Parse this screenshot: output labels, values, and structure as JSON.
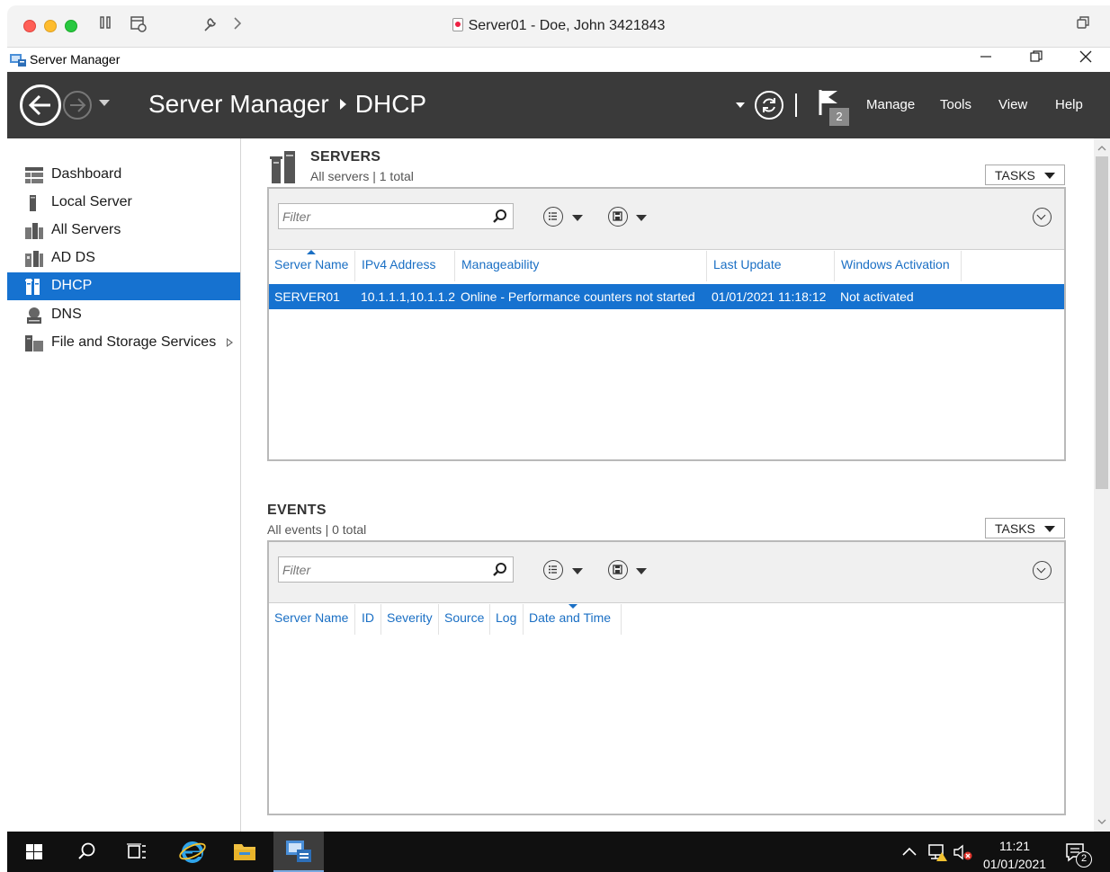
{
  "window": {
    "mac_title": "Server01 - Doe, John 3421843",
    "app_name": "Server Manager"
  },
  "header": {
    "breadcrumb_root": "Server Manager",
    "breadcrumb_current": "DHCP",
    "flag_count": "2",
    "menu": [
      "Manage",
      "Tools",
      "View",
      "Help"
    ]
  },
  "sidebar": {
    "items": [
      {
        "label": "Dashboard",
        "icon": "dashboard-icon"
      },
      {
        "label": "Local Server",
        "icon": "local-server-icon"
      },
      {
        "label": "All Servers",
        "icon": "all-servers-icon"
      },
      {
        "label": "AD DS",
        "icon": "ad-ds-icon"
      },
      {
        "label": "DHCP",
        "icon": "dhcp-icon",
        "active": true
      },
      {
        "label": "DNS",
        "icon": "dns-icon"
      },
      {
        "label": "File and Storage Services",
        "icon": "file-storage-icon",
        "has_submenu": true
      }
    ]
  },
  "servers": {
    "title": "SERVERS",
    "subtitle": "All servers | 1 total",
    "tasks_label": "TASKS",
    "filter_placeholder": "Filter",
    "columns": [
      "Server Name",
      "IPv4 Address",
      "Manageability",
      "Last Update",
      "Windows Activation"
    ],
    "rows": [
      {
        "server_name": "SERVER01",
        "ipv4": "10.1.1.1,10.1.1.2",
        "manageability": "Online - Performance counters not started",
        "last_update": "01/01/2021 11:18:12",
        "activation": "Not activated"
      }
    ]
  },
  "events": {
    "title": "EVENTS",
    "subtitle": "All events | 0 total",
    "tasks_label": "TASKS",
    "filter_placeholder": "Filter",
    "columns": [
      "Server Name",
      "ID",
      "Severity",
      "Source",
      "Log",
      "Date and Time"
    ]
  },
  "taskbar": {
    "time": "11:21",
    "date": "01/01/2021",
    "notification_count": "2"
  },
  "colors": {
    "accent": "#1672d0",
    "header_bg": "#3a3a3a",
    "link": "#1a6fc4"
  }
}
